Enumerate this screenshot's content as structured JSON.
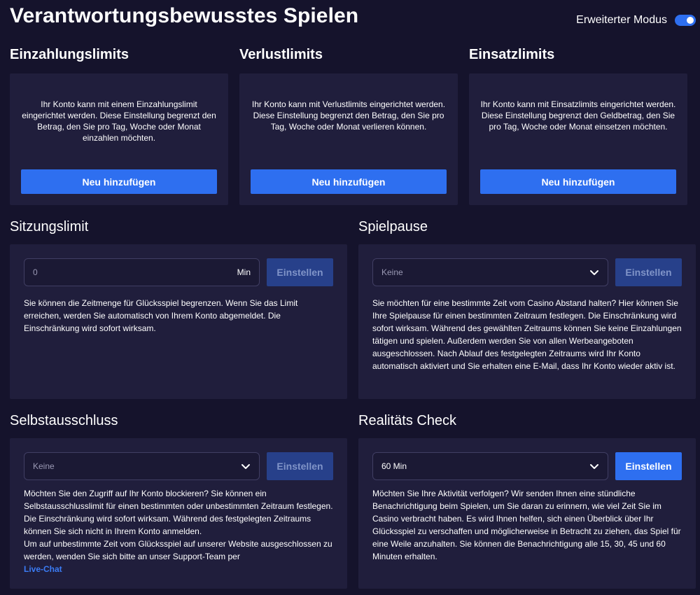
{
  "page": {
    "title": "Verantwortungsbewusstes Spielen",
    "mode_label": "Erweiterter Modus"
  },
  "limits": [
    {
      "title": "Einzahlungslimits",
      "text": "Ihr Konto kann mit einem Einzahlungslimit eingerichtet werden. Diese Einstellung begrenzt den Betrag, den Sie pro Tag, Woche oder Monat einzahlen möchten.",
      "button": "Neu hinzufügen"
    },
    {
      "title": "Verlustlimits",
      "text": "Ihr Konto kann mit Verlustlimits eingerichtet werden. Diese Einstellung begrenzt den Betrag, den Sie pro Tag, Woche oder Monat verlieren können.",
      "button": "Neu hinzufügen"
    },
    {
      "title": "Einsatzlimits",
      "text": "Ihr Konto kann mit Einsatzlimits eingerichtet werden. Diese Einstellung begrenzt den Geldbetrag, den Sie pro Tag, Woche oder Monat einsetzen möchten.",
      "button": "Neu hinzufügen"
    }
  ],
  "session": {
    "title": "Sitzungslimit",
    "input_value": "0",
    "unit": "Min",
    "button": "Einstellen",
    "text": "Sie können die Zeitmenge für Glücksspiel begrenzen. Wenn Sie das Limit erreichen, werden Sie automatisch von Ihrem Konto abgemeldet. Die Einschränkung wird sofort wirksam."
  },
  "pause": {
    "title": "Spielpause",
    "select_value": "Keine",
    "button": "Einstellen",
    "text": "Sie möchten für eine bestimmte Zeit vom Casino Abstand halten? Hier können Sie Ihre Spielpause für einen bestimmten Zeitraum festlegen. Die Einschränkung wird sofort wirksam. Während des gewählten Zeitraums können Sie keine Einzahlungen tätigen und spielen. Außerdem werden Sie von allen Werbeangeboten ausgeschlossen. Nach Ablauf des festgelegten Zeitraums wird Ihr Konto automatisch aktiviert und Sie erhalten eine E-Mail, dass Ihr Konto wieder aktiv ist."
  },
  "exclusion": {
    "title": "Selbstausschluss",
    "select_value": "Keine",
    "button": "Einstellen",
    "text": "Möchten Sie den Zugriff auf Ihr Konto blockieren? Sie können ein Selbstausschlusslimit für einen bestimmten oder unbestimmten Zeitraum festlegen. Die Einschränkung wird sofort wirksam. Während des festgelegten Zeitraums können Sie sich nicht in Ihrem Konto anmelden.",
    "text2": "Um auf unbestimmte Zeit vom Glücksspiel auf unserer Website ausgeschlossen zu werden, wenden Sie sich bitte an unser Support-Team per",
    "link": "Live-Chat"
  },
  "reality": {
    "title": "Realitäts Check",
    "select_value": "60 Min",
    "button": "Einstellen",
    "text": "Möchten Sie Ihre Aktivität verfolgen? Wir senden Ihnen eine stündliche Benachrichtigung beim Spielen, um Sie daran zu erinnern, wie viel Zeit Sie im Casino verbracht haben. Es wird Ihnen helfen, sich einen Überblick über Ihr Glücksspiel zu verschaffen und möglicherweise in Betracht zu ziehen, das Spiel für eine Weile anzuhalten. Sie können die Benachrichtigung alle 15, 30, 45 und 60 Minuten erhalten."
  },
  "colors": {
    "background": "#15132c",
    "card": "#201e3c",
    "accent": "#2e6ff0",
    "disabled_button": "#27408a",
    "link": "#3b7cf5"
  },
  "icons": {
    "select_chevron": "chevron-down-icon"
  }
}
